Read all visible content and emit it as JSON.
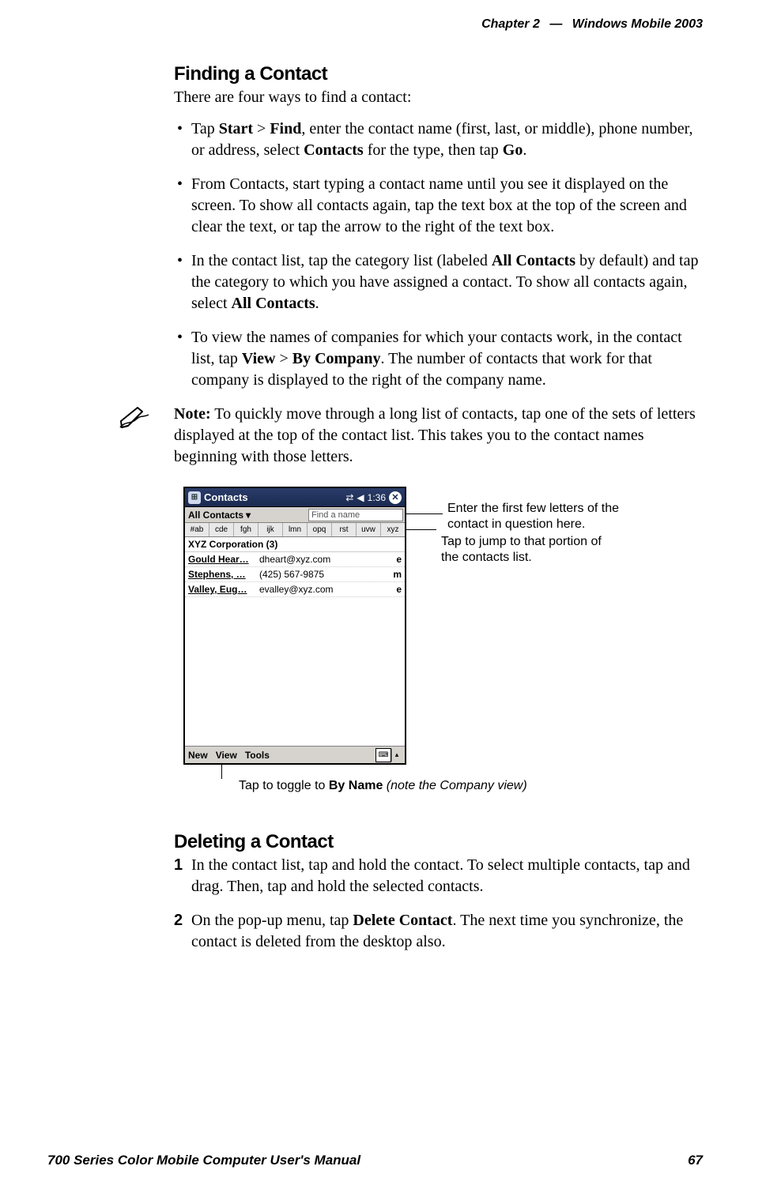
{
  "header": {
    "chapter_label": "Chapter",
    "chapter_number": "2",
    "dash": "—",
    "doc_title": "Windows Mobile 2003"
  },
  "finding": {
    "title": "Finding a Contact",
    "intro": "There are four ways to find a contact:",
    "bullets": [
      "Tap <b>Start</b> > <b>Find</b>, enter the contact name (first, last, or middle), phone number, or address, select <b>Contacts</b> for the type, then tap <b>Go</b>.",
      "From Contacts, start typing a contact name until you see it displayed on the screen. To show all contacts again, tap the text box at the top of the screen and clear the text, or tap the arrow to the right of the text box.",
      "In the contact list, tap the category list (labeled <b>All Contacts</b> by default) and tap the category to which you have assigned a contact. To show all contacts again, select <b>All Contacts</b>.",
      "To view the names of companies for which your contacts work, in the contact list, tap <b>View</b> > <b>By Company</b>. The number of contacts that work for that company is displayed to the right of the company name."
    ],
    "note_html": "<b>Note:</b> To quickly move through a long list of contacts, tap one of the sets of letters displayed at the top of the contact list. This takes you to the contact names beginning with those letters."
  },
  "screenshot": {
    "title": "Contacts",
    "clock": "1:36",
    "category_label": "All Contacts",
    "find_placeholder": "Find a name",
    "alpha_tabs": [
      "#ab",
      "cde",
      "fgh",
      "ijk",
      "lmn",
      "opq",
      "rst",
      "uvw",
      "xyz"
    ],
    "group_row": "XYZ Corporation (3)",
    "rows": [
      {
        "name": "Gould Hear…",
        "value": "dheart@xyz.com",
        "type": "e"
      },
      {
        "name": "Stephens, …",
        "value": "(425) 567-9875",
        "type": "m"
      },
      {
        "name": "Valley, Eug…",
        "value": "evalley@xyz.com",
        "type": "e"
      }
    ],
    "menu": [
      "New",
      "View",
      "Tools"
    ]
  },
  "callouts": {
    "find_text": "Enter the first few letters of the contact in question here.",
    "alpha_text": "Tap to jump to that portion of the contacts list.",
    "view_text_html": "Tap to toggle to <b>By Name</b> <i>(note the Company view)</i>"
  },
  "deleting": {
    "title": "Deleting a Contact",
    "steps": [
      "In the contact list, tap and hold the contact. To select multiple contacts, tap and drag. Then, tap and hold the selected contacts.",
      "On the pop-up menu, tap <b>Delete Contact</b>. The next time you synchronize, the contact is deleted from the desktop also."
    ]
  },
  "footer": {
    "manual_title": "700 Series Color Mobile Computer User's Manual",
    "page_number": "67"
  }
}
